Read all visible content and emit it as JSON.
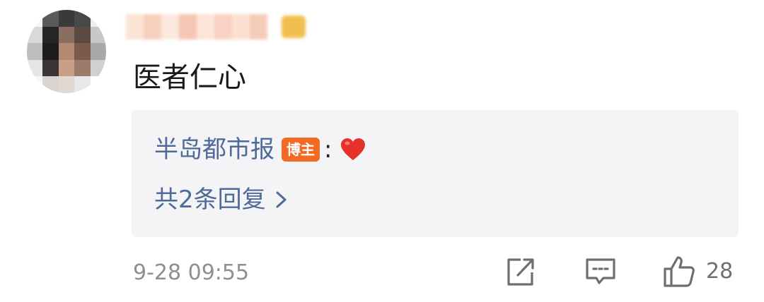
{
  "comment": {
    "text": "医者仁心",
    "timestamp": "9-28 09:55",
    "like_count": "28"
  },
  "reply": {
    "author": "半岛都市报",
    "badge": "博主",
    "separator": ":",
    "content_icon": "red-heart-icon",
    "reply_count_label": "共2条回复"
  },
  "actions": {
    "share_icon": "share-icon",
    "comment_icon": "comment-icon",
    "like_icon": "thumbs-up-icon"
  },
  "colors": {
    "link_blue": "#4e6a98",
    "badge_orange": "#f26b24",
    "heart_red": "#e4322b",
    "reply_background": "#f4f4f6",
    "muted_gray": "#8f8f8f"
  }
}
